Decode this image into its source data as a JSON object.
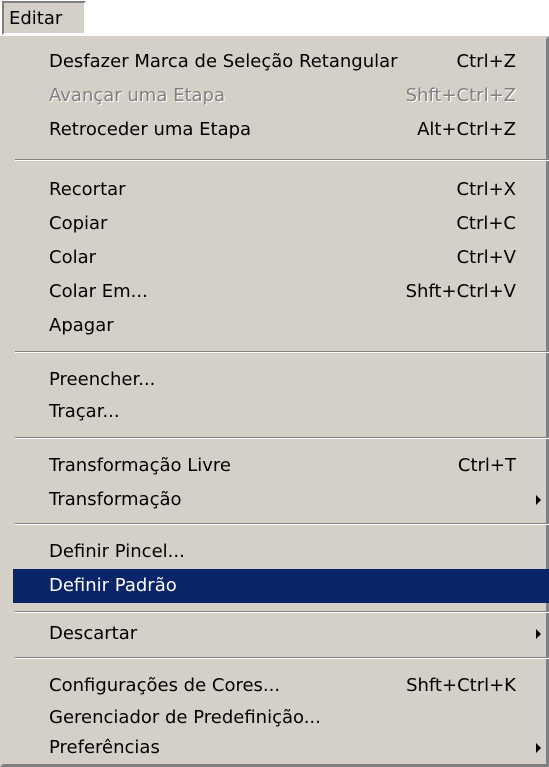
{
  "menubar": {
    "title": "Editar"
  },
  "menu": {
    "items": [
      {
        "label": "Desfazer Marca de Seleção Retangular",
        "shortcut": "Ctrl+Z"
      },
      {
        "label": "Avançar uma Etapa",
        "shortcut": "Shft+Ctrl+Z",
        "disabled": true
      },
      {
        "label": "Retroceder uma Etapa",
        "shortcut": "Alt+Ctrl+Z"
      },
      {
        "label": "Recortar",
        "shortcut": "Ctrl+X"
      },
      {
        "label": "Copiar",
        "shortcut": "Ctrl+C"
      },
      {
        "label": "Colar",
        "shortcut": "Ctrl+V"
      },
      {
        "label": "Colar Em...",
        "shortcut": "Shft+Ctrl+V"
      },
      {
        "label": "Apagar"
      },
      {
        "label": "Preencher..."
      },
      {
        "label": "Traçar..."
      },
      {
        "label": "Transformação Livre",
        "shortcut": "Ctrl+T"
      },
      {
        "label": "Transformação",
        "submenu_icon": "triangle-right-icon"
      },
      {
        "label": "Definir Pincel..."
      },
      {
        "label": "Definir Padrão",
        "selected": true
      },
      {
        "label": "Descartar",
        "submenu_icon": "triangle-right-icon"
      },
      {
        "label": "Configurações de Cores...",
        "shortcut": "Shft+Ctrl+K"
      },
      {
        "label": "Gerenciador de Predefinição..."
      },
      {
        "label": "Preferências",
        "submenu_icon": "triangle-right-icon"
      }
    ]
  },
  "colors": {
    "menu_background": "#d4d0c8",
    "highlight": "#0a246a",
    "disabled_text": "#808080"
  }
}
